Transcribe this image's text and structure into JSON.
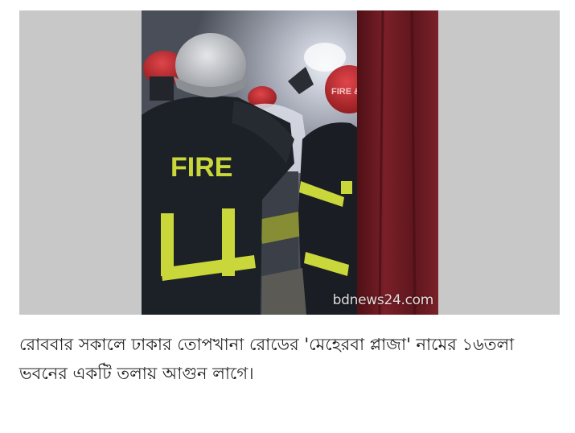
{
  "photo": {
    "helmet_text_left": "",
    "vest_text": "FIRE",
    "helmet_text_right": "FIRE & R",
    "watermark": "bdnews24.com",
    "palette": {
      "side_bg": "#c8c8c8",
      "smoke": "#8e919c",
      "jacket": "#1c2027",
      "reflective": "#c9d73a",
      "helmet_red": "#c2262b",
      "helmet_silver": "#b9bcc0",
      "curtain": "#6e1a22"
    }
  },
  "caption": {
    "text": "রোববার সকালে ঢাকার তোপখানা রোডের 'মেহেরবা প্লাজা' নামের ১৬তলা ভবনের একটি তলায় আগুন লাগে।"
  }
}
